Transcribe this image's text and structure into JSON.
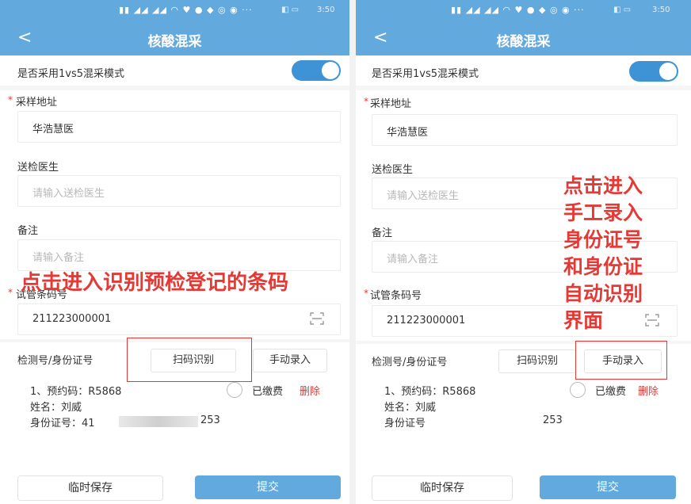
{
  "status_time": "3:50",
  "header": {
    "back": "<",
    "title": "核酸混采"
  },
  "form": {
    "toggle_label": "是否采用1vs5混采模式",
    "toggle_on": true,
    "site_label": "采样地址",
    "site_value": "华浩慧医",
    "doctor_label": "送检医生",
    "doctor_placeholder": "请输入送检医生",
    "note_label": "备注",
    "note_placeholder": "请输入备注",
    "tube_label": "试管条码号",
    "tube_value": "211223000001",
    "detect_label": "检测号/身份证号",
    "scan_button": "扫码识别",
    "manual_button": "手动录入"
  },
  "record": {
    "appointment": "1、预约码：R5868",
    "paid_label": "已缴费",
    "delete_label": "删除",
    "name": "姓名：刘威",
    "id_label_left": "身份证号：41",
    "id_tail": "253",
    "id_label_right": "身份证号"
  },
  "footer": {
    "save": "临时保存",
    "submit": "提交"
  },
  "annotations": {
    "left": "点击进入识别预检登记的条码",
    "right": "点击进入\n手工录入\n身份证号\n和身份证\n自动识别\n界面"
  },
  "colors": {
    "primary": "#62a9dd",
    "toggle": "#3e93d6",
    "annotation": "#e53935"
  }
}
